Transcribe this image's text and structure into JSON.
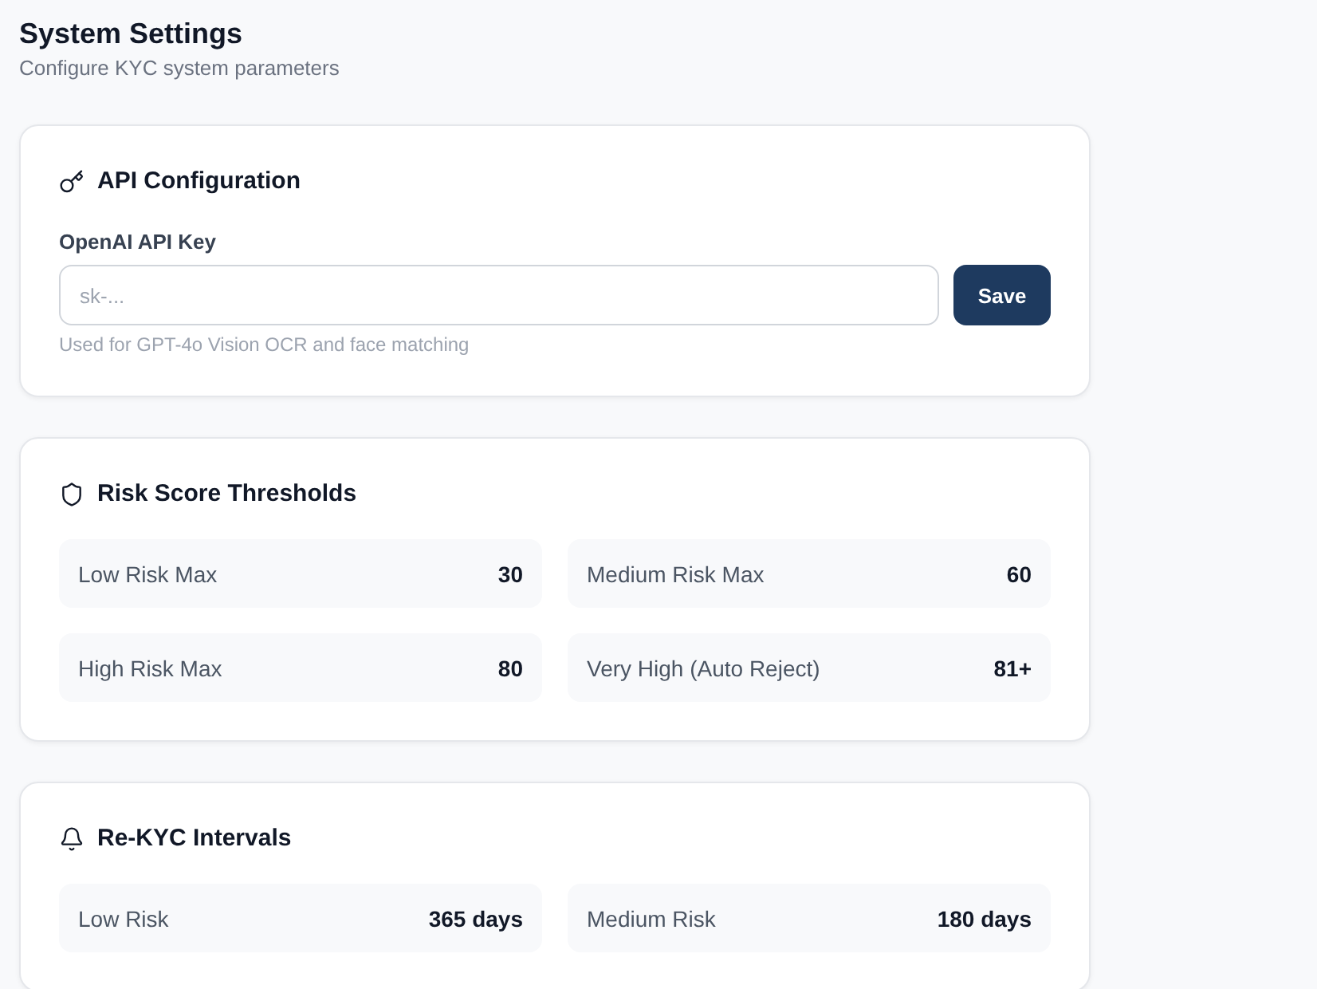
{
  "page": {
    "title": "System Settings",
    "subtitle": "Configure KYC system parameters"
  },
  "api_configuration": {
    "title": "API Configuration",
    "field": {
      "label": "OpenAI API Key",
      "placeholder": "sk-...",
      "hint": "Used for GPT-4o Vision OCR and face matching"
    },
    "button": "Save"
  },
  "risk_score_thresholds": {
    "title": "Risk Score Thresholds",
    "items": [
      {
        "label": "Low Risk Max",
        "value": "30"
      },
      {
        "label": "Medium Risk Max",
        "value": "60"
      },
      {
        "label": "High Risk Max",
        "value": "80"
      },
      {
        "label": "Very High (Auto Reject)",
        "value": "81+"
      }
    ]
  },
  "re_kyc_intervals": {
    "title": "Re-KYC Intervals",
    "items": [
      {
        "label": "Low Risk",
        "value": "365 days"
      },
      {
        "label": "Medium Risk",
        "value": "180 days"
      }
    ]
  }
}
